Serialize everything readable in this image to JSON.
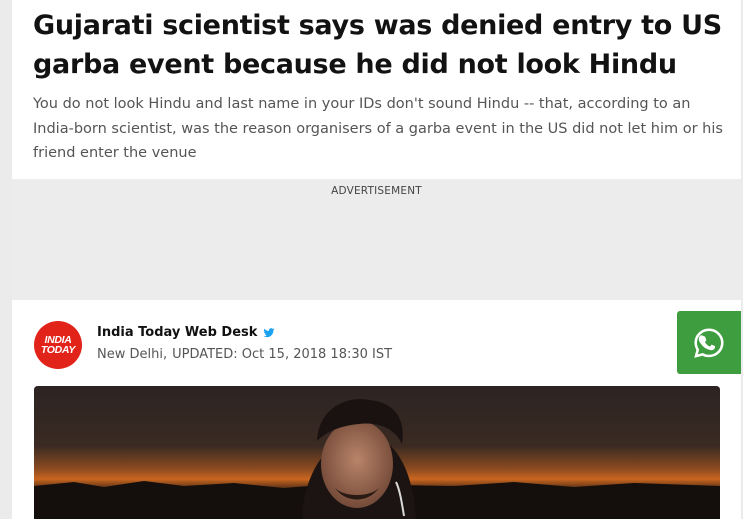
{
  "article": {
    "headline": "Gujarati scientist says was denied entry to US garba event because he did not look Hindu",
    "summary": "You do not look Hindu and last name in your IDs don't sound Hindu -- that, according to an India-born scientist, was the reason organisers of a garba event in the US did not let him or his friend enter the venue"
  },
  "advertisement": {
    "label": "ADVERTISEMENT"
  },
  "byline": {
    "logo_line1": "INDIA",
    "logo_line2": "TODAY",
    "author": "India Today Web Desk",
    "location": "New Delhi,",
    "updated": "UPDATED: Oct 15, 2018 18:30 IST",
    "author_icon": "twitter-bird-icon"
  },
  "share": {
    "whatsapp_icon": "whatsapp-icon"
  },
  "colors": {
    "brand_red": "#e2231a",
    "whatsapp_green": "#3e9d3e",
    "twitter_blue": "#1da1f2",
    "headline": "#121212",
    "summary": "#555555"
  }
}
